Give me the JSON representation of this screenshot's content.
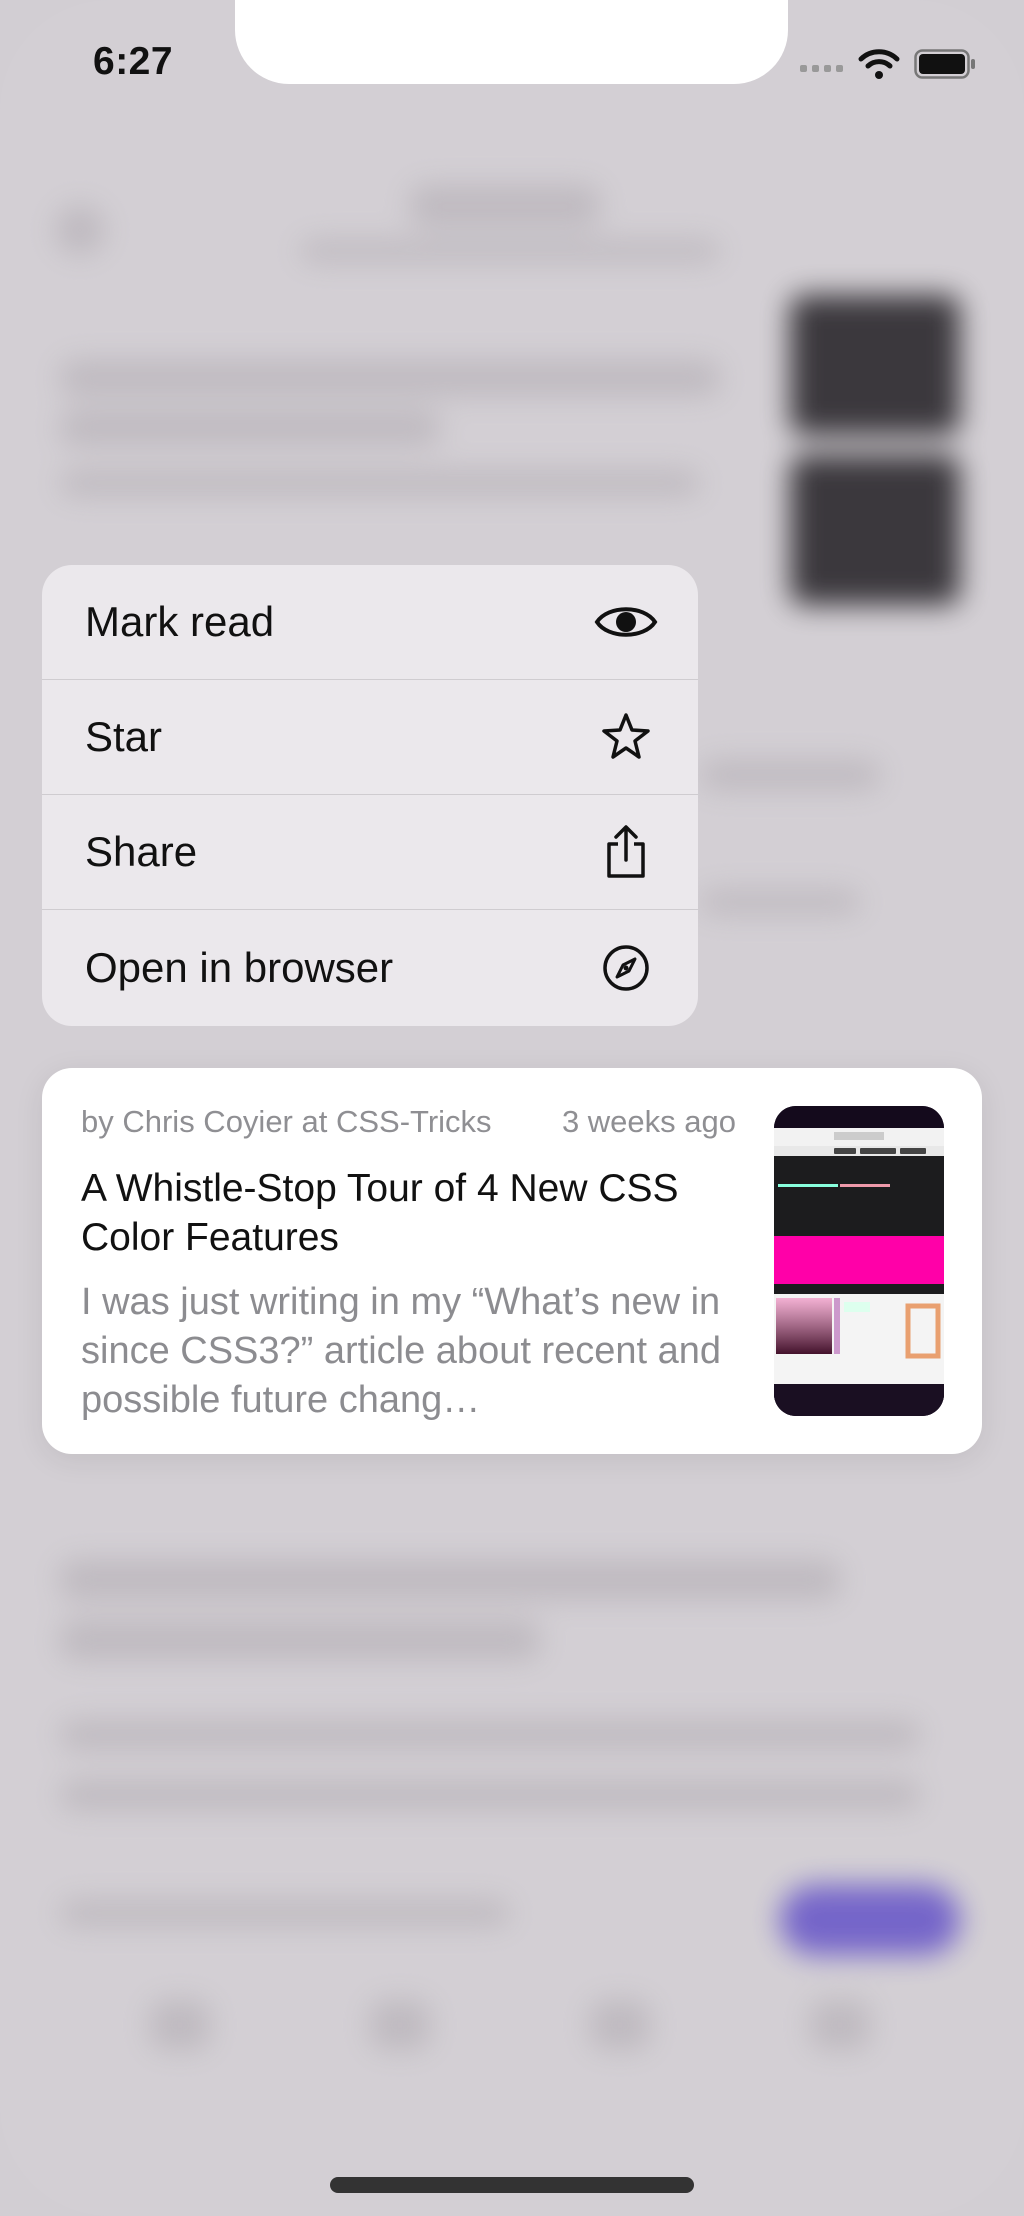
{
  "status_bar": {
    "time": "6:27",
    "icons": [
      "cellular-signal-icon",
      "wifi-icon",
      "battery-icon"
    ]
  },
  "context_menu": {
    "items": [
      {
        "label": "Mark read",
        "icon": "eye-icon"
      },
      {
        "label": "Star",
        "icon": "star-icon"
      },
      {
        "label": "Share",
        "icon": "share-icon"
      },
      {
        "label": "Open in browser",
        "icon": "compass-icon"
      }
    ]
  },
  "article_preview": {
    "byline": "by Chris Coyier at CSS-Tricks",
    "age": "3 weeks ago",
    "title": "A Whistle-Stop Tour of 4 New CSS Color Features",
    "summary": "I was just writing in my “What’s new in since CSS3?” article about recent and possible future chang…",
    "thumbnail": "article-thumbnail-image"
  }
}
